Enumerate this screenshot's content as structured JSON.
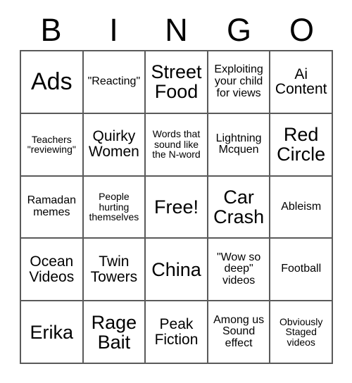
{
  "card": {
    "header_letters": [
      "B",
      "I",
      "N",
      "G",
      "O"
    ],
    "grid_size": 5,
    "colors": {
      "background": "#ffffff",
      "text": "#000000",
      "border": "#5a5a5a"
    },
    "rows": [
      [
        {
          "label": "Ads",
          "size": "fs-xl"
        },
        {
          "label": "\"Reacting\"",
          "size": "fs-sm"
        },
        {
          "label": "Street Food",
          "size": "fs-lg"
        },
        {
          "label": "Exploiting your child for views",
          "size": "fs-sm"
        },
        {
          "label": "Ai Content",
          "size": "fs-md"
        }
      ],
      [
        {
          "label": "Teachers \"reviewing\"",
          "size": "fs-xs"
        },
        {
          "label": "Quirky Women",
          "size": "fs-md"
        },
        {
          "label": "Words that sound like the N-word",
          "size": "fs-xs"
        },
        {
          "label": "Lightning Mcquen",
          "size": "fs-sm"
        },
        {
          "label": "Red Circle",
          "size": "fs-lg"
        }
      ],
      [
        {
          "label": "Ramadan memes",
          "size": "fs-sm"
        },
        {
          "label": "People hurting themselves",
          "size": "fs-xs"
        },
        {
          "label": "Free!",
          "size": "fs-lg"
        },
        {
          "label": "Car Crash",
          "size": "fs-lg"
        },
        {
          "label": "Ableism",
          "size": "fs-sm"
        }
      ],
      [
        {
          "label": "Ocean Videos",
          "size": "fs-md"
        },
        {
          "label": "Twin Towers",
          "size": "fs-md"
        },
        {
          "label": "China",
          "size": "fs-lg"
        },
        {
          "label": "\"Wow so deep\" videos",
          "size": "fs-sm"
        },
        {
          "label": "Football",
          "size": "fs-sm"
        }
      ],
      [
        {
          "label": "Erika",
          "size": "fs-lg"
        },
        {
          "label": "Rage Bait",
          "size": "fs-lg"
        },
        {
          "label": "Peak Fiction",
          "size": "fs-md"
        },
        {
          "label": "Among us Sound effect",
          "size": "fs-sm"
        },
        {
          "label": "Obviously Staged videos",
          "size": "fs-xs"
        }
      ]
    ]
  }
}
